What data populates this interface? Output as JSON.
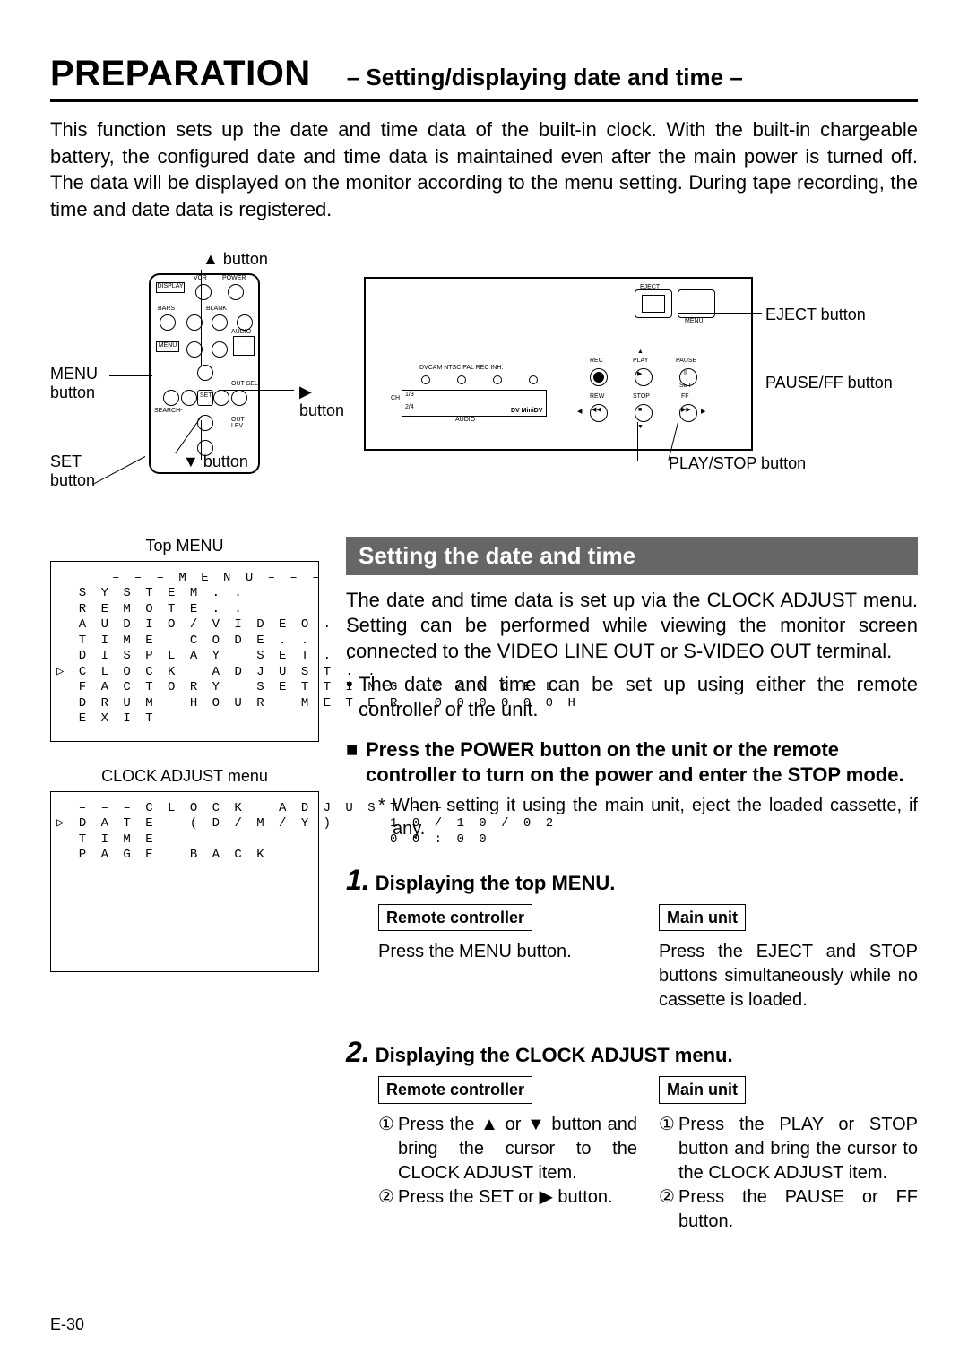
{
  "header": {
    "title": "PREPARATION",
    "subtitle": "– Setting/displaying date and time –"
  },
  "intro": "This function sets up the date and time data of the built-in clock. With the built-in chargeable battery, the configured date and time data is maintained even after the main power is turned off. The data will be displayed on the monitor according to the menu setting. During tape recording, the time and date data is registered.",
  "remote_labels": {
    "up": "button",
    "right": "button",
    "down": "button",
    "menu": "MENU button",
    "set": "SET button"
  },
  "deck_labels": {
    "eject": "EJECT button",
    "pause_ff": "PAUSE/FF button",
    "play_stop": "PLAY/STOP button"
  },
  "section_title": "Setting the date and time",
  "top_menu_title": "Top MENU",
  "top_menu": "     – – – M E N U – – –\n  S Y S T E M . .\n  R E M O T E . .\n  A U D I O / V I D E O . .\n  T I M E   C O D E . .\n  D I S P L A Y   S E T . .\n▷ C L O C K   A D J U S T . .\n  F A C T O R Y   S E T T I N G   C A N C E L\n  D R U M   H O U R   M E T E R   0 0 0 0 0 0 H\n  E X I T",
  "clock_menu_title": "CLOCK ADJUST menu",
  "clock_menu": "  – – – C L O C K   A D J U S T – – –\n▷ D A T E   ( D / M / Y )     1 0 / 1 0 / 0 2\n  T I M E                     0 0 : 0 0\n  P A G E   B A C K",
  "right_para": "The date and time data is set up via the CLOCK ADJUST menu. Setting can be performed while viewing the monitor screen connected to the VIDEO LINE OUT or S-VIDEO OUT terminal.",
  "right_bullet": "The date and time can be set up using either the remote controller or the unit.",
  "heading": "Press the POWER button on the unit or the remote controller to turn on the power and enter the STOP mode.",
  "sub_note": "When setting it using the main unit, eject the loaded cassette, if any.",
  "steps": [
    {
      "num": "1.",
      "title": "Displaying the top MENU.",
      "left_label": "Remote controller",
      "left_body": [
        {
          "n": "",
          "t": "Press the MENU button."
        }
      ],
      "right_label": "Main unit",
      "right_body": [
        {
          "n": "",
          "t": "Press the EJECT and STOP buttons simultaneously while no cassette is loaded."
        }
      ]
    },
    {
      "num": "2.",
      "title": "Displaying the CLOCK ADJUST menu.",
      "left_label": "Remote controller",
      "left_body": [
        {
          "n": "①",
          "t": "Press the ▲ or ▼ button and bring the cursor to the CLOCK ADJUST item."
        },
        {
          "n": "②",
          "t": "Press the SET or ▶ button."
        }
      ],
      "right_label": "Main unit",
      "right_body": [
        {
          "n": "①",
          "t": "Press the PLAY or STOP button and bring the cursor to the CLOCK ADJUST item."
        },
        {
          "n": "②",
          "t": "Press the PAUSE or FF button."
        }
      ]
    }
  ],
  "page_number": "E-30"
}
